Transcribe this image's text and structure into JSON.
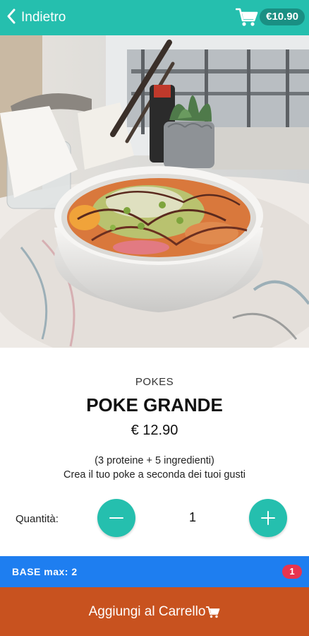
{
  "header": {
    "back_label": "Indietro",
    "cart_total": "€10.90",
    "icons": {
      "back": "chevron-left-icon",
      "cart": "shopping-cart-icon"
    },
    "colors": {
      "bar": "#25bfae",
      "total_pill": "#1a8f83"
    }
  },
  "hero": {
    "description_icon": "poke-bowl-photo"
  },
  "product": {
    "category": "POKES",
    "name": "POKE GRANDE",
    "price": "€ 12.90",
    "description_line1": "(3 proteine + 5 ingredienti)",
    "description_line2": "Crea il tuo poke a seconda dei tuoi gusti"
  },
  "quantity": {
    "label": "Quantità:",
    "value": "1",
    "icons": {
      "decrease": "minus-icon",
      "increase": "plus-icon"
    }
  },
  "options": {
    "base_label": "BASE max: 2",
    "base_badge": "1",
    "colors": {
      "bar": "#1e7ef0",
      "badge": "#e8344f"
    }
  },
  "footer": {
    "add_label": "Aggiungi al Carrello",
    "icon": "cart-icon",
    "color": "#c8521f"
  }
}
